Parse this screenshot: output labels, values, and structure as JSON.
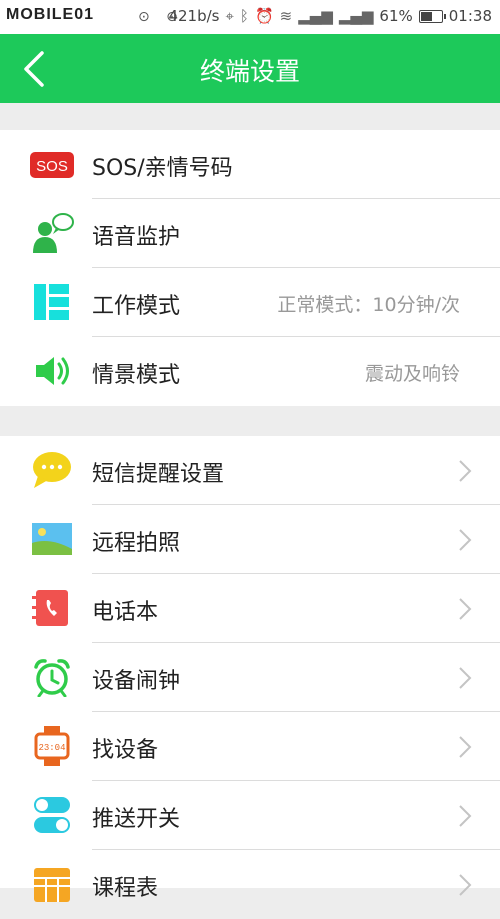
{
  "status_bar": {
    "logo": "MOBILE01",
    "speed": "421b/s",
    "battery": "61%",
    "battery_level": 0.61,
    "time": "01:38"
  },
  "header": {
    "title": "终端设置",
    "color": "#1dc95a"
  },
  "group1": [
    {
      "label": "SOS/亲情号码",
      "value": "",
      "icon": "sos-icon"
    },
    {
      "label": "语音监护",
      "value": "",
      "icon": "voice-monitor-icon"
    },
    {
      "label": "工作模式",
      "value": "正常模式：10分钟/次",
      "icon": "work-mode-icon"
    },
    {
      "label": "情景模式",
      "value": "震动及响铃",
      "icon": "speaker-icon"
    }
  ],
  "group2": [
    {
      "label": "短信提醒设置",
      "icon": "sms-icon"
    },
    {
      "label": "远程拍照",
      "icon": "photo-icon"
    },
    {
      "label": "电话本",
      "icon": "phonebook-icon"
    },
    {
      "label": "设备闹钟",
      "icon": "alarm-clock-icon"
    },
    {
      "label": "找设备",
      "icon": "watch-icon"
    },
    {
      "label": "推送开关",
      "icon": "toggle-icon"
    },
    {
      "label": "课程表",
      "icon": "timetable-icon"
    }
  ]
}
